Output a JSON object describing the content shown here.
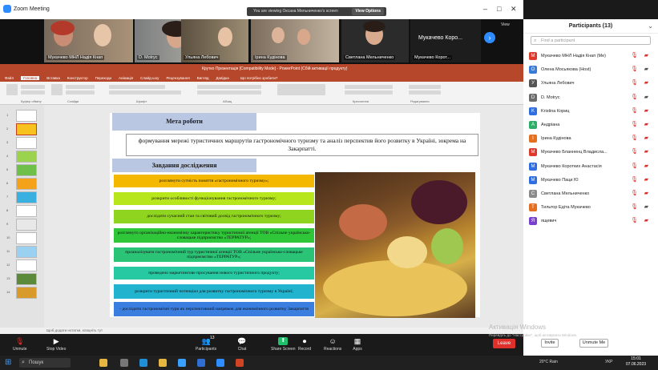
{
  "zoom": {
    "window_title": "Zoom Meeting",
    "banner_text": "You are viewing Оксана Мельниченко's screen",
    "view_options": "View Options",
    "view_label": "View",
    "video_tiles": [
      "Мукачево МНЛ Надія Кнап",
      "D. Motryc",
      "Ульяна Лебович",
      "Ірина Кудінова",
      "Светлана Мельниченко",
      "Мукачево Корот..."
    ],
    "strip_overflow_label": "Мукачево Коро...",
    "toolbar": [
      {
        "id": "unmute",
        "label": "Unmute",
        "icon": "mic-off-icon"
      },
      {
        "id": "stop-video",
        "label": "Stop Video",
        "icon": "video-icon"
      },
      {
        "id": "participants",
        "label": "Participants",
        "icon": "participants-icon"
      },
      {
        "id": "chat",
        "label": "Chat",
        "icon": "chat-icon"
      },
      {
        "id": "share-screen",
        "label": "Share Screen",
        "icon": "share-screen-icon"
      },
      {
        "id": "record",
        "label": "Record",
        "icon": "record-icon"
      },
      {
        "id": "reactions",
        "label": "Reactions",
        "icon": "reactions-icon"
      },
      {
        "id": "apps",
        "label": "Apps",
        "icon": "apps-icon"
      }
    ],
    "participants_count": "13",
    "leave_label": "Leave"
  },
  "participants_panel": {
    "title": "Participants (13)",
    "search_placeholder": "Find a participant",
    "list": [
      {
        "name": "Мукачево МНЛ Надія Кнап (Me)",
        "initial": "М",
        "color": "#e0392b"
      },
      {
        "name": "Олена Мосьякова (Host)",
        "initial": "О",
        "color": "#3a7bd5"
      },
      {
        "name": "Ульяна Лебович",
        "initial": "У",
        "color": "#555555"
      },
      {
        "name": "D. Motryc",
        "initial": "D",
        "color": "#6b6b6b"
      },
      {
        "name": "Kristina Кориц",
        "initial": "K",
        "color": "#2f6ee0"
      },
      {
        "name": "Андріана",
        "initial": "А",
        "color": "#2cae66"
      },
      {
        "name": "Ірина Кудінова",
        "initial": "І",
        "color": "#e36f1f"
      },
      {
        "name": "Мукачево Бланненц Владисла...",
        "initial": "М",
        "color": "#e0392b"
      },
      {
        "name": "Мукачево Коротких Анастасія",
        "initial": "М",
        "color": "#2f6ee0"
      },
      {
        "name": "Мукачево Паци Ю",
        "initial": "М",
        "color": "#2f6ee0"
      },
      {
        "name": "Светлана Мельниченко",
        "initial": "С",
        "color": "#8a8a8a"
      },
      {
        "name": "Тильтор Едіта Мукачево",
        "initial": "Т",
        "color": "#e36f1f"
      },
      {
        "name": "ящевич",
        "initial": "Я",
        "color": "#7b3fd0"
      }
    ],
    "invite_label": "Invite",
    "unmute_me_label": "Unmute Me"
  },
  "powerpoint": {
    "title": "Крутко Презентація [Compatibility Mode] - PowerPoint (Сбій активації продукту)",
    "search_hint": "Що потрібно зробити?",
    "tabs": [
      "Файл",
      "Головна",
      "Вставка",
      "Конструктор",
      "Переходи",
      "Анімація",
      "Слайд-шоу",
      "Рецензування",
      "Вигляд",
      "Довідка"
    ],
    "active_tab": "Головна",
    "ribbon_groups": [
      "Буфер обміну",
      "Слайди",
      "Шрифт",
      "Абзац",
      "Креслення",
      "Редагування"
    ],
    "status_hint": "Щоб додати нотатки, клацніть тут",
    "thumb_count": 14
  },
  "slide": {
    "goal_heading": "Мета роботи",
    "goal_text": "формування мережі туристичних маршрутів гастрономічного туризму та аналіз перспектив його розвитку в Україні, зокрема на Закарпатті.",
    "tasks_heading": "Завдання дослідження",
    "tasks": [
      {
        "text": "розглянути сутність поняття «гастрономічного туризму»;",
        "color": "#f5b800"
      },
      {
        "text": "розкрити особливості функціонування гастрономічного туризму;",
        "color": "#b7e61c"
      },
      {
        "text": "дослідити сучасний стан та світовий досвід гастрономічного туризму;",
        "color": "#8fd51f"
      },
      {
        "text": "розглянуто організаційно-економічну характеристику туристичної агенції ТОВ «Спільне українсько-словацьке підприємство «ТЕРРАТУР»;",
        "color": "#2fc63a"
      },
      {
        "text": "проаналізувати гастрономічний тур туристичної агенції ТОВ «Спільне українсько-словацьке підприємство «ТЕРРАТУР»;",
        "color": "#2bc477"
      },
      {
        "text": "проведено маркетингове просування нового туристичного продукту;",
        "color": "#26c9a2"
      },
      {
        "text": "розкрити туристичний потенціал для розвитку гастрономічного туризму в Україні;",
        "color": "#22b3cf"
      },
      {
        "text": "- дослідити гастрономічні тури як перспективний напрямок для економічного розвитку Закарпаття",
        "color": "#3a7ee0"
      }
    ]
  },
  "windows": {
    "activate_title": "Активація Windows",
    "activate_text": "Перейдіть до \"Настройки\", щоб активувати Windows.",
    "search_label": "Пошук",
    "weather": "20°C Rain",
    "lang": "УКР",
    "time": "15:01",
    "date": "07.06.2023"
  }
}
